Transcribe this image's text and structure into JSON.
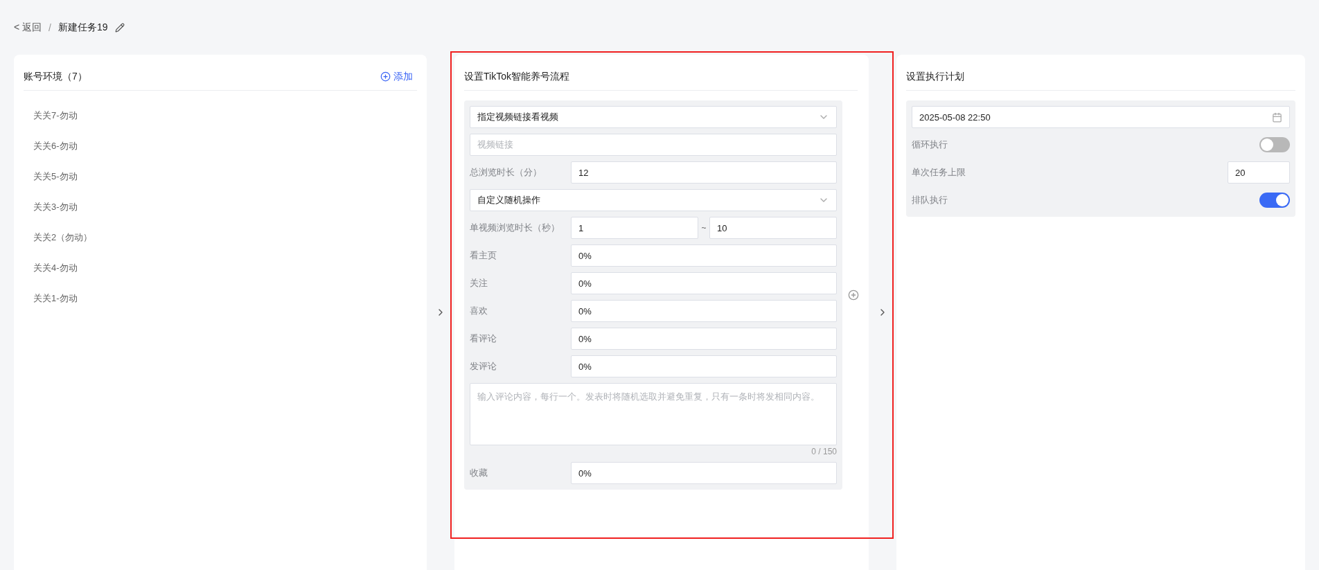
{
  "breadcrumb": {
    "back": "< 返回",
    "separator": "/",
    "title": "新建任务19"
  },
  "accounts": {
    "title": "账号环境（7）",
    "add": "添加",
    "items": [
      {
        "label": "关关7-勿动"
      },
      {
        "label": "关关6-勿动"
      },
      {
        "label": "关关5-勿动"
      },
      {
        "label": "关关3-勿动"
      },
      {
        "label": "关关2（勿动）"
      },
      {
        "label": "关关4-勿动"
      },
      {
        "label": "关关1-勿动"
      }
    ]
  },
  "flow": {
    "title": "设置TikTok智能养号流程",
    "highlighted": true,
    "fields": [
      {
        "kind": "select",
        "value": "指定视频链接看视频"
      },
      {
        "kind": "input",
        "placeholder": "视频链接"
      },
      {
        "kind": "labeled",
        "label": "总浏览时长（分）",
        "value": "12"
      },
      {
        "kind": "select",
        "value": "自定义随机操作"
      },
      {
        "kind": "range",
        "label": "单视频浏览时长（秒）",
        "from": "1",
        "separator": "~",
        "to": "10"
      },
      {
        "kind": "labeled",
        "label": "看主页",
        "value": "0%"
      },
      {
        "kind": "labeled",
        "label": "关注",
        "value": "0%"
      },
      {
        "kind": "labeled",
        "label": "喜欢",
        "value": "0%"
      },
      {
        "kind": "labeled",
        "label": "看评论",
        "value": "0%"
      },
      {
        "kind": "labeled",
        "label": "发评论",
        "value": "0%"
      },
      {
        "kind": "textarea",
        "placeholder": "输入评论内容，每行一个。发表时将随机选取并避免重复，只有一条时将发相同内容。",
        "counter": "0 / 150"
      },
      {
        "kind": "labeled",
        "label": "收藏",
        "value": "0%"
      }
    ]
  },
  "plan": {
    "title": "设置执行计划",
    "fields": [
      {
        "kind": "date",
        "value": "2025-05-08 22:50"
      },
      {
        "kind": "toggle",
        "label": "循环执行",
        "on": false
      },
      {
        "kind": "number",
        "label": "单次任务上限",
        "value": "20"
      },
      {
        "kind": "toggle",
        "label": "排队执行",
        "on": true
      }
    ]
  }
}
